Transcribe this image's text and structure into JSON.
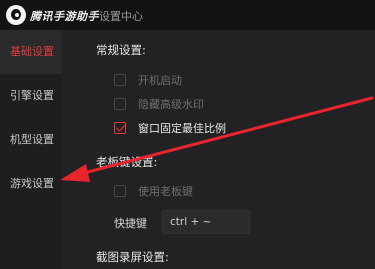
{
  "titlebar": {
    "app_name": "腾讯手游助手",
    "subtitle": "· 设置中心"
  },
  "sidebar": {
    "items": [
      {
        "label": "基础设置",
        "active": true
      },
      {
        "label": "引擎设置",
        "active": false
      },
      {
        "label": "机型设置",
        "active": false
      },
      {
        "label": "游戏设置",
        "active": false
      }
    ]
  },
  "general": {
    "title": "常规设置:",
    "options": [
      {
        "label": "开机启动",
        "checked": false
      },
      {
        "label": "隐藏高级水印",
        "checked": false
      },
      {
        "label": "窗口固定最佳比例",
        "checked": true
      }
    ]
  },
  "boss_key": {
    "title": "老板键设置:",
    "use_label": "使用老板键",
    "use_checked": false,
    "hotkey_label": "快捷键",
    "hotkey_value": "ctrl + ~"
  },
  "screenshot": {
    "title": "截图录屏设置:"
  },
  "colors": {
    "accent": "#e23b3b",
    "arrow": "#e8242c"
  }
}
